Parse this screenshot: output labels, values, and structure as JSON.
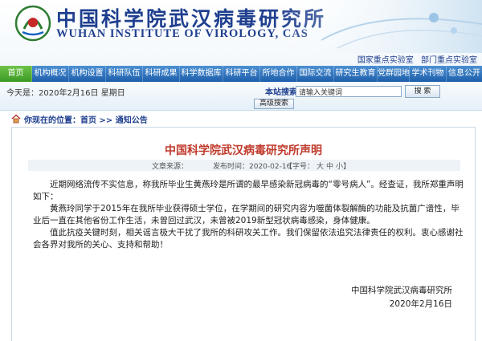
{
  "header": {
    "cn_title": "中国科学院武汉病毒研究所",
    "en_title": "WUHAN INSTITUTE OF VIROLOGY, CAS",
    "lab_links": [
      "国家重点实验室",
      "部门重点实验室"
    ],
    "brand_color": "#1f3f8f"
  },
  "nav": {
    "items": [
      "首页",
      "机构概况",
      "机构设置",
      "科研队伍",
      "科研成果",
      "科学数据库",
      "科研平台",
      "所地合作",
      "国际交流",
      "研究生教育",
      "党群园地",
      "学术刊物",
      "信息公开"
    ],
    "active_index": 0
  },
  "infobar": {
    "date": "今天是：2020年2月16日  星期日",
    "search_label": "本站搜索：",
    "search_value": "请输入关键词",
    "search_button": "搜 索",
    "advanced_button": "高级搜索"
  },
  "breadcrumb": {
    "prefix": "你现在的位置：",
    "items": [
      "首页",
      "通知公告"
    ],
    "separator": " >> "
  },
  "article": {
    "title": "中国科学院武汉病毒研究所声明",
    "source_label": "文章来源：",
    "published": "发布时间：2020-02-16",
    "font_size_label": "【字号：",
    "font_sizes": [
      "大",
      "中",
      "小"
    ],
    "font_size_end": "】",
    "title_color": "#c0392b",
    "paragraphs": [
      "近期网络流传不实信息，称我所毕业生黄燕玲是所谓的最早感染新冠病毒的“零号病人”。经查证，我所郑重声明如下：",
      "黄燕玲同学于2015年在我所毕业获得硕士学位，在学期间的研究内容为噬菌体裂解酶的功能及抗菌广谱性，毕业后一直在其他省份工作生活，未曾回过武汉，未曾被2019新型冠状病毒感染，身体健康。",
      "值此抗疫关键时刻，相关谣言极大干扰了我所的科研攻关工作。我们保留依法追究法律责任的权利。衷心感谢社会各界对我所的关心、支持和帮助！"
    ],
    "signature": "中国科学院武汉病毒研究所",
    "signature_date": "2020年2月16日"
  }
}
